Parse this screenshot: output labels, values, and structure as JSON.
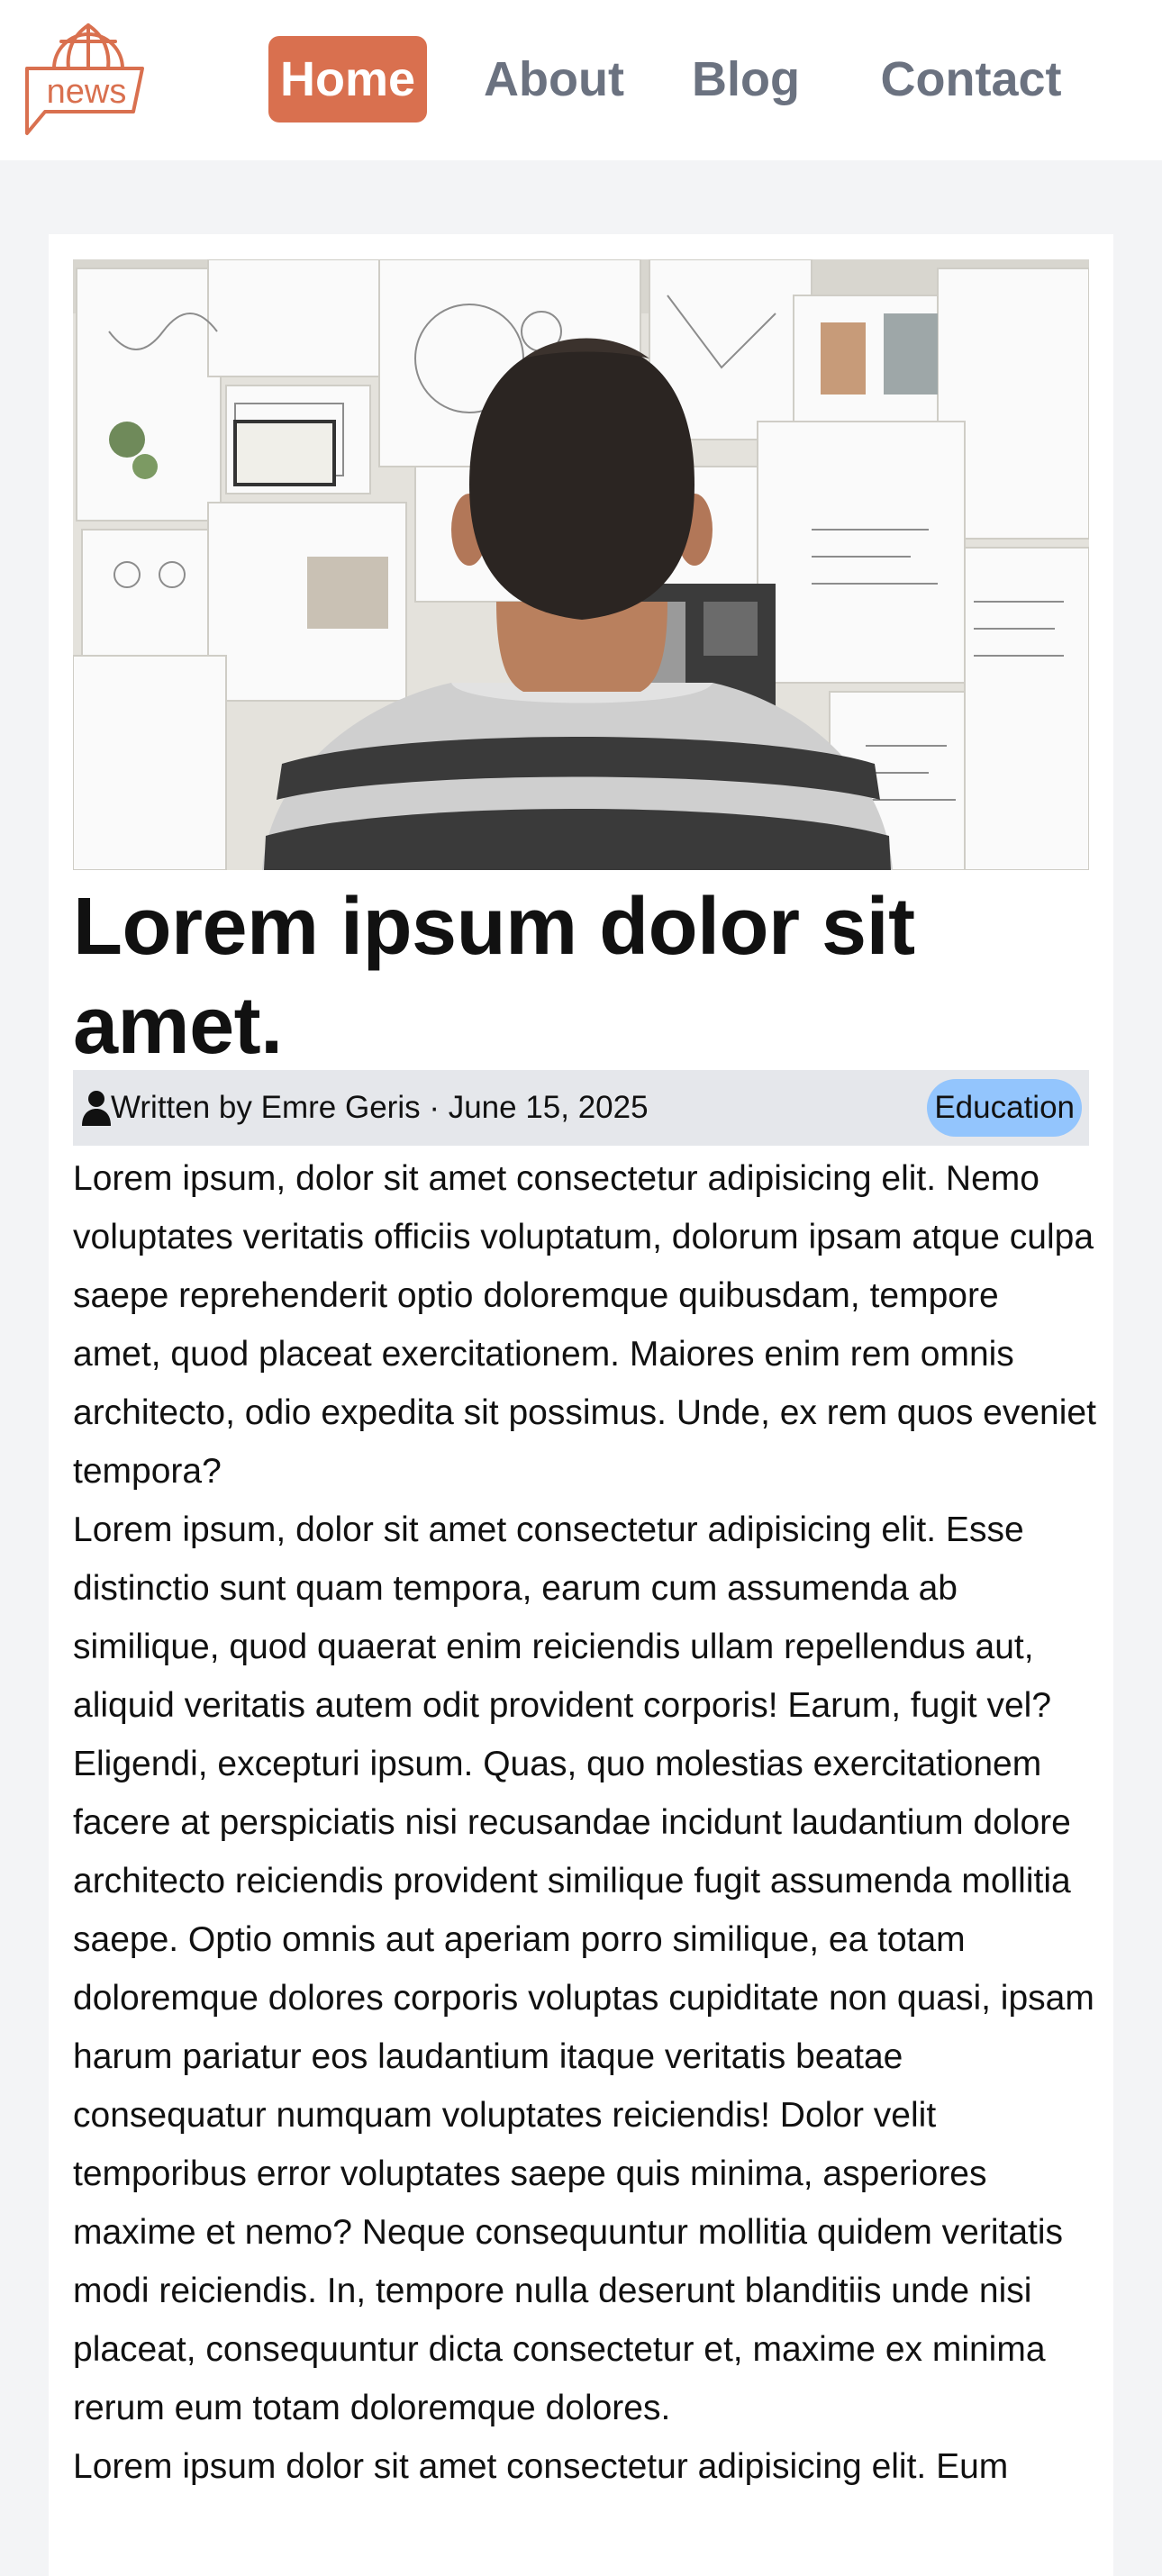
{
  "header": {
    "logo_text": "news",
    "nav": [
      {
        "label": "Home",
        "active": true
      },
      {
        "label": "About",
        "active": false
      },
      {
        "label": "Blog",
        "active": false
      },
      {
        "label": "Contact",
        "active": false
      }
    ]
  },
  "article": {
    "hero_image_alt": "person looking at wall of sketches",
    "title": "Lorem ipsum dolor sit amet.",
    "meta": {
      "author_icon": "user-icon",
      "written_by": "Written by Emre Geris · June 15, 2025",
      "category": "Education"
    },
    "paragraphs": [
      "Lorem ipsum, dolor sit amet consectetur adipisicing elit. Nemo voluptates veritatis officiis voluptatum, dolorum ipsam atque culpa saepe reprehenderit optio doloremque quibusdam, tempore amet, quod placeat exercitationem. Maiores enim rem omnis architecto, odio expedita sit possimus. Unde, ex rem quos eveniet tempora?",
      "Lorem ipsum, dolor sit amet consectetur adipisicing elit. Esse distinctio sunt quam tempora, earum cum assumenda ab similique, quod quaerat enim reiciendis ullam repellendus aut, aliquid veritatis autem odit provident corporis! Earum, fugit vel? Eligendi, excepturi ipsum. Quas, quo molestias exercitationem facere at perspiciatis nisi recusandae incidunt laudantium dolore architecto reiciendis provident similique fugit assumenda mollitia saepe. Optio omnis aut aperiam porro similique, ea totam doloremque dolores corporis voluptas cupiditate non quasi, ipsam harum pariatur eos laudantium itaque veritatis beatae consequatur numquam voluptates reiciendis! Dolor velit temporibus error voluptates saepe quis minima, asperiores maxime et nemo? Neque consequuntur mollitia quidem veritatis modi reiciendis. In, tempore nulla deserunt blanditiis unde nisi placeat, consequuntur dicta consectetur et, maxime ex minima rerum eum totam doloremque dolores.",
      "Lorem ipsum dolor sit amet consectetur adipisicing elit. Eum"
    ]
  },
  "colors": {
    "accent": "#d9704f",
    "nav_inactive": "#6b7280",
    "page_bg": "#f3f4f6",
    "meta_bg": "#e5e7eb",
    "badge_bg": "#93c5fd"
  }
}
